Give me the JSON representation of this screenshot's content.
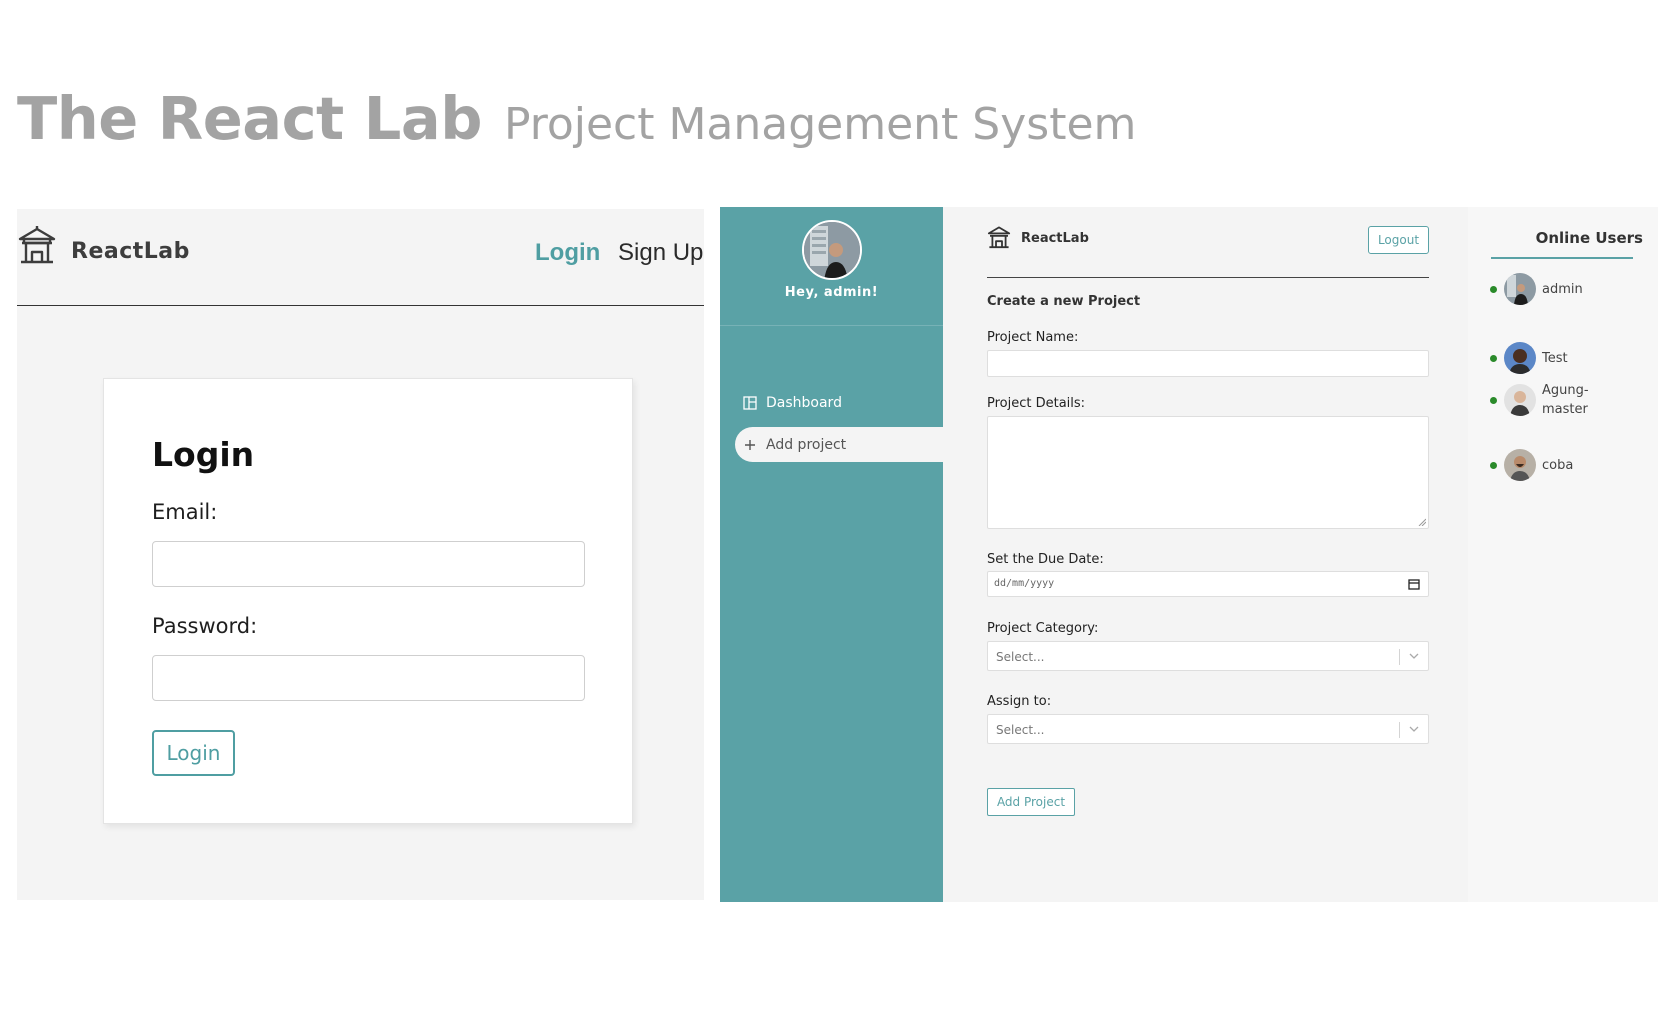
{
  "hero": {
    "title": "The React Lab",
    "subtitle": "Project Management System"
  },
  "login_screen": {
    "brand": "ReactLab",
    "nav": {
      "login": "Login",
      "signup": "Sign Up"
    },
    "card": {
      "title": "Login",
      "email_label": "Email:",
      "password_label": "Password:",
      "submit": "Login"
    }
  },
  "dashboard": {
    "sidebar": {
      "greeting": "Hey, admin!",
      "items": [
        {
          "label": "Dashboard",
          "icon": "dashboard-icon",
          "active": false
        },
        {
          "label": "Add project",
          "icon": "plus-icon",
          "active": true
        }
      ]
    },
    "header": {
      "brand": "ReactLab",
      "logout": "Logout"
    },
    "form": {
      "heading": "Create a new Project",
      "name_label": "Project Name:",
      "details_label": "Project Details:",
      "due_label": "Set the Due Date:",
      "due_placeholder": "dd/mm/yyyy",
      "category_label": "Project Category:",
      "category_placeholder": "Select...",
      "assign_label": "Assign to:",
      "assign_placeholder": "Select...",
      "submit": "Add Project"
    },
    "online_users": {
      "title": "Online Users",
      "users": [
        {
          "name": "admin"
        },
        {
          "name": "Test"
        },
        {
          "name": "Agung-master"
        },
        {
          "name": "coba"
        }
      ]
    }
  },
  "colors": {
    "accent": "#5aa2a6",
    "online": "#2a8a2a",
    "hero_text": "#a3a3a3"
  }
}
